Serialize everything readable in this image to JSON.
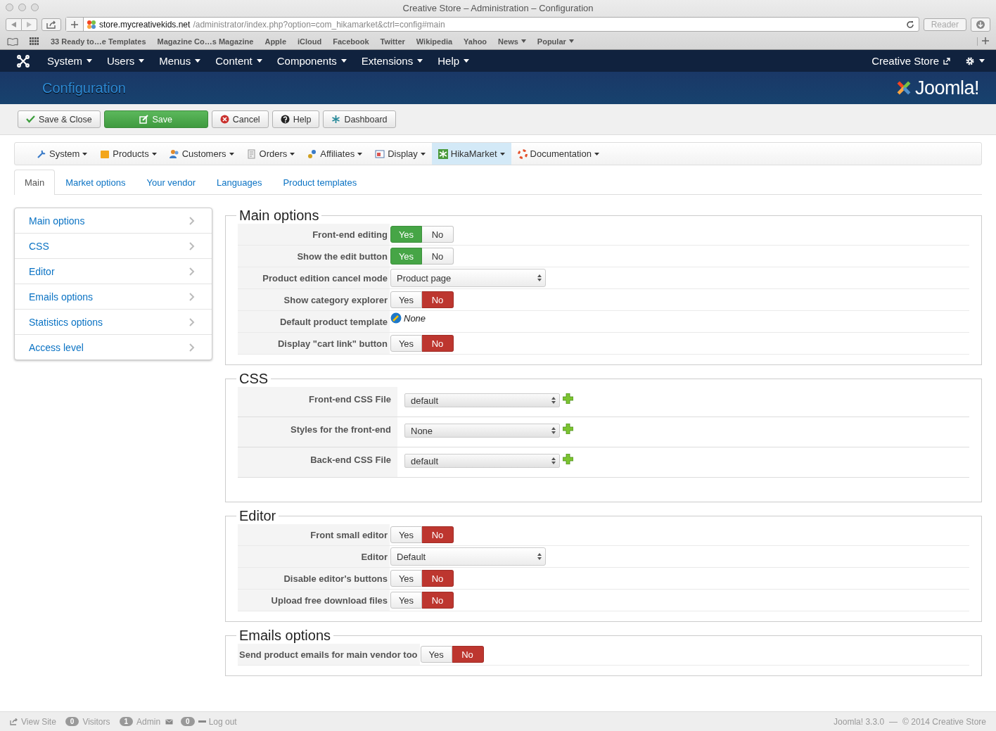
{
  "browser": {
    "title": "Creative Store – Administration – Configuration",
    "url_host": "store.mycreativekids.net",
    "url_path": "/administrator/index.php?option=com_hikamarket&ctrl=config#main",
    "reader": "Reader",
    "bookmarks": [
      {
        "label": "33 Ready to…e Templates",
        "menu": false
      },
      {
        "label": "Magazine Co…s Magazine",
        "menu": false
      },
      {
        "label": "Apple",
        "menu": false
      },
      {
        "label": "iCloud",
        "menu": false
      },
      {
        "label": "Facebook",
        "menu": false
      },
      {
        "label": "Twitter",
        "menu": false
      },
      {
        "label": "Wikipedia",
        "menu": false
      },
      {
        "label": "Yahoo",
        "menu": false
      },
      {
        "label": "News",
        "menu": true
      },
      {
        "label": "Popular",
        "menu": true
      }
    ]
  },
  "admin_menu": {
    "items": [
      "System",
      "Users",
      "Menus",
      "Content",
      "Components",
      "Extensions",
      "Help"
    ],
    "site_link": "Creative Store"
  },
  "header": {
    "title": "Configuration",
    "brand": "Joomla!"
  },
  "toolbar": [
    {
      "label": "Save & Close",
      "primary": false
    },
    {
      "label": "Save",
      "primary": true
    },
    {
      "label": "Cancel",
      "primary": false
    },
    {
      "label": "Help",
      "primary": false
    },
    {
      "label": "Dashboard",
      "primary": false
    }
  ],
  "component_menu": [
    {
      "label": "System",
      "selected": false
    },
    {
      "label": "Products",
      "selected": false
    },
    {
      "label": "Customers",
      "selected": false
    },
    {
      "label": "Orders",
      "selected": false
    },
    {
      "label": "Affiliates",
      "selected": false
    },
    {
      "label": "Display",
      "selected": false
    },
    {
      "label": "HikaMarket",
      "selected": true
    },
    {
      "label": "Documentation",
      "selected": false
    }
  ],
  "tabs": [
    {
      "label": "Main",
      "selected": true
    },
    {
      "label": "Market options",
      "selected": false
    },
    {
      "label": "Your vendor",
      "selected": false
    },
    {
      "label": "Languages",
      "selected": false
    },
    {
      "label": "Product templates",
      "selected": false
    }
  ],
  "sidebar": [
    "Main options",
    "CSS",
    "Editor",
    "Emails options",
    "Statistics options",
    "Access level"
  ],
  "sections": [
    {
      "title": "Main options",
      "kind": "compact",
      "rows": [
        {
          "label": "Front-end editing",
          "kind": "toggle",
          "options": [
            {
              "label": "Yes",
              "selected": true
            },
            {
              "label": "No",
              "selected": false
            }
          ]
        },
        {
          "label": "Show the edit button",
          "kind": "toggle",
          "options": [
            {
              "label": "Yes",
              "selected": true
            },
            {
              "label": "No",
              "selected": false
            }
          ]
        },
        {
          "label": "Product edition cancel mode",
          "kind": "select",
          "value": "Product page"
        },
        {
          "label": "Show category explorer",
          "kind": "toggle",
          "options": [
            {
              "label": "Yes",
              "selected": false
            },
            {
              "label": "No",
              "selected": true
            }
          ]
        },
        {
          "label": "Default product template",
          "kind": "link",
          "value": "None"
        },
        {
          "label": "Display \"cart link\" button",
          "kind": "toggle",
          "options": [
            {
              "label": "Yes",
              "selected": false
            },
            {
              "label": "No",
              "selected": true
            }
          ]
        }
      ]
    },
    {
      "title": "CSS",
      "kind": "table",
      "rows": [
        {
          "label": "Front-end CSS File",
          "kind": "file",
          "value": "default"
        },
        {
          "label": "Styles for the front-end",
          "kind": "file",
          "value": "None"
        },
        {
          "label": "Back-end CSS File",
          "kind": "file",
          "value": "default"
        }
      ]
    },
    {
      "title": "Editor",
      "kind": "compact",
      "rows": [
        {
          "label": "Front small editor",
          "kind": "toggle",
          "options": [
            {
              "label": "Yes",
              "selected": false
            },
            {
              "label": "No",
              "selected": true
            }
          ]
        },
        {
          "label": "Editor",
          "kind": "select",
          "value": "Default"
        },
        {
          "label": "Disable editor's buttons",
          "kind": "toggle",
          "options": [
            {
              "label": "Yes",
              "selected": false
            },
            {
              "label": "No",
              "selected": true
            }
          ]
        },
        {
          "label": "Upload free download files",
          "kind": "toggle",
          "options": [
            {
              "label": "Yes",
              "selected": false
            },
            {
              "label": "No",
              "selected": true
            }
          ]
        }
      ]
    },
    {
      "title": "Emails options",
      "kind": "compact",
      "rows": [
        {
          "label": "Send product emails for main vendor too",
          "kind": "toggle",
          "options": [
            {
              "label": "Yes",
              "selected": false
            },
            {
              "label": "No",
              "selected": true
            }
          ]
        }
      ]
    }
  ],
  "footer": {
    "view_site": "View Site",
    "visitors_count": "0",
    "visitors": "Visitors",
    "admin_count": "1",
    "admin": "Admin",
    "messages_count": "0",
    "logout": "Log out",
    "version": "Joomla! 3.3.0",
    "separator": "—",
    "copyright": "© 2014 Creative Store"
  }
}
